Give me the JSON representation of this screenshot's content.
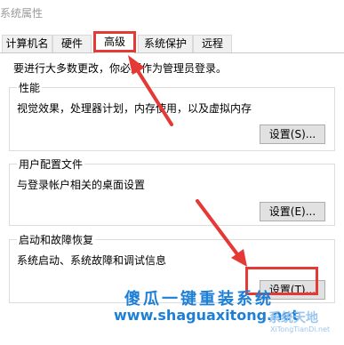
{
  "window": {
    "title": "系统属性"
  },
  "tabs": [
    "计算机名",
    "硬件",
    "高级",
    "系统保护",
    "远程"
  ],
  "content": {
    "admin_note": "要进行大多数更改，你必须作为管理员登录。",
    "performance": {
      "title": "性能",
      "description": "视觉效果，处理器计划，内存使用，以及虚拟内存",
      "button": "设置(S)..."
    },
    "user_profiles": {
      "title": "用户配置文件",
      "description": "与登录帐户相关的桌面设置",
      "button": "设置(E)..."
    },
    "startup_recovery": {
      "title": "启动和故障恢复",
      "description": "系统启动、系统故障和调试信息",
      "button": "设置(T)..."
    }
  },
  "watermark": {
    "chinese": "傻瓜一键重装系统",
    "url": "www.shaguaxitong.net",
    "logo_text": "系统天地",
    "logo_sub": "XiTongTianDi.net"
  },
  "colors": {
    "highlight": "#e53935",
    "watermark": "#1e7fd6"
  }
}
